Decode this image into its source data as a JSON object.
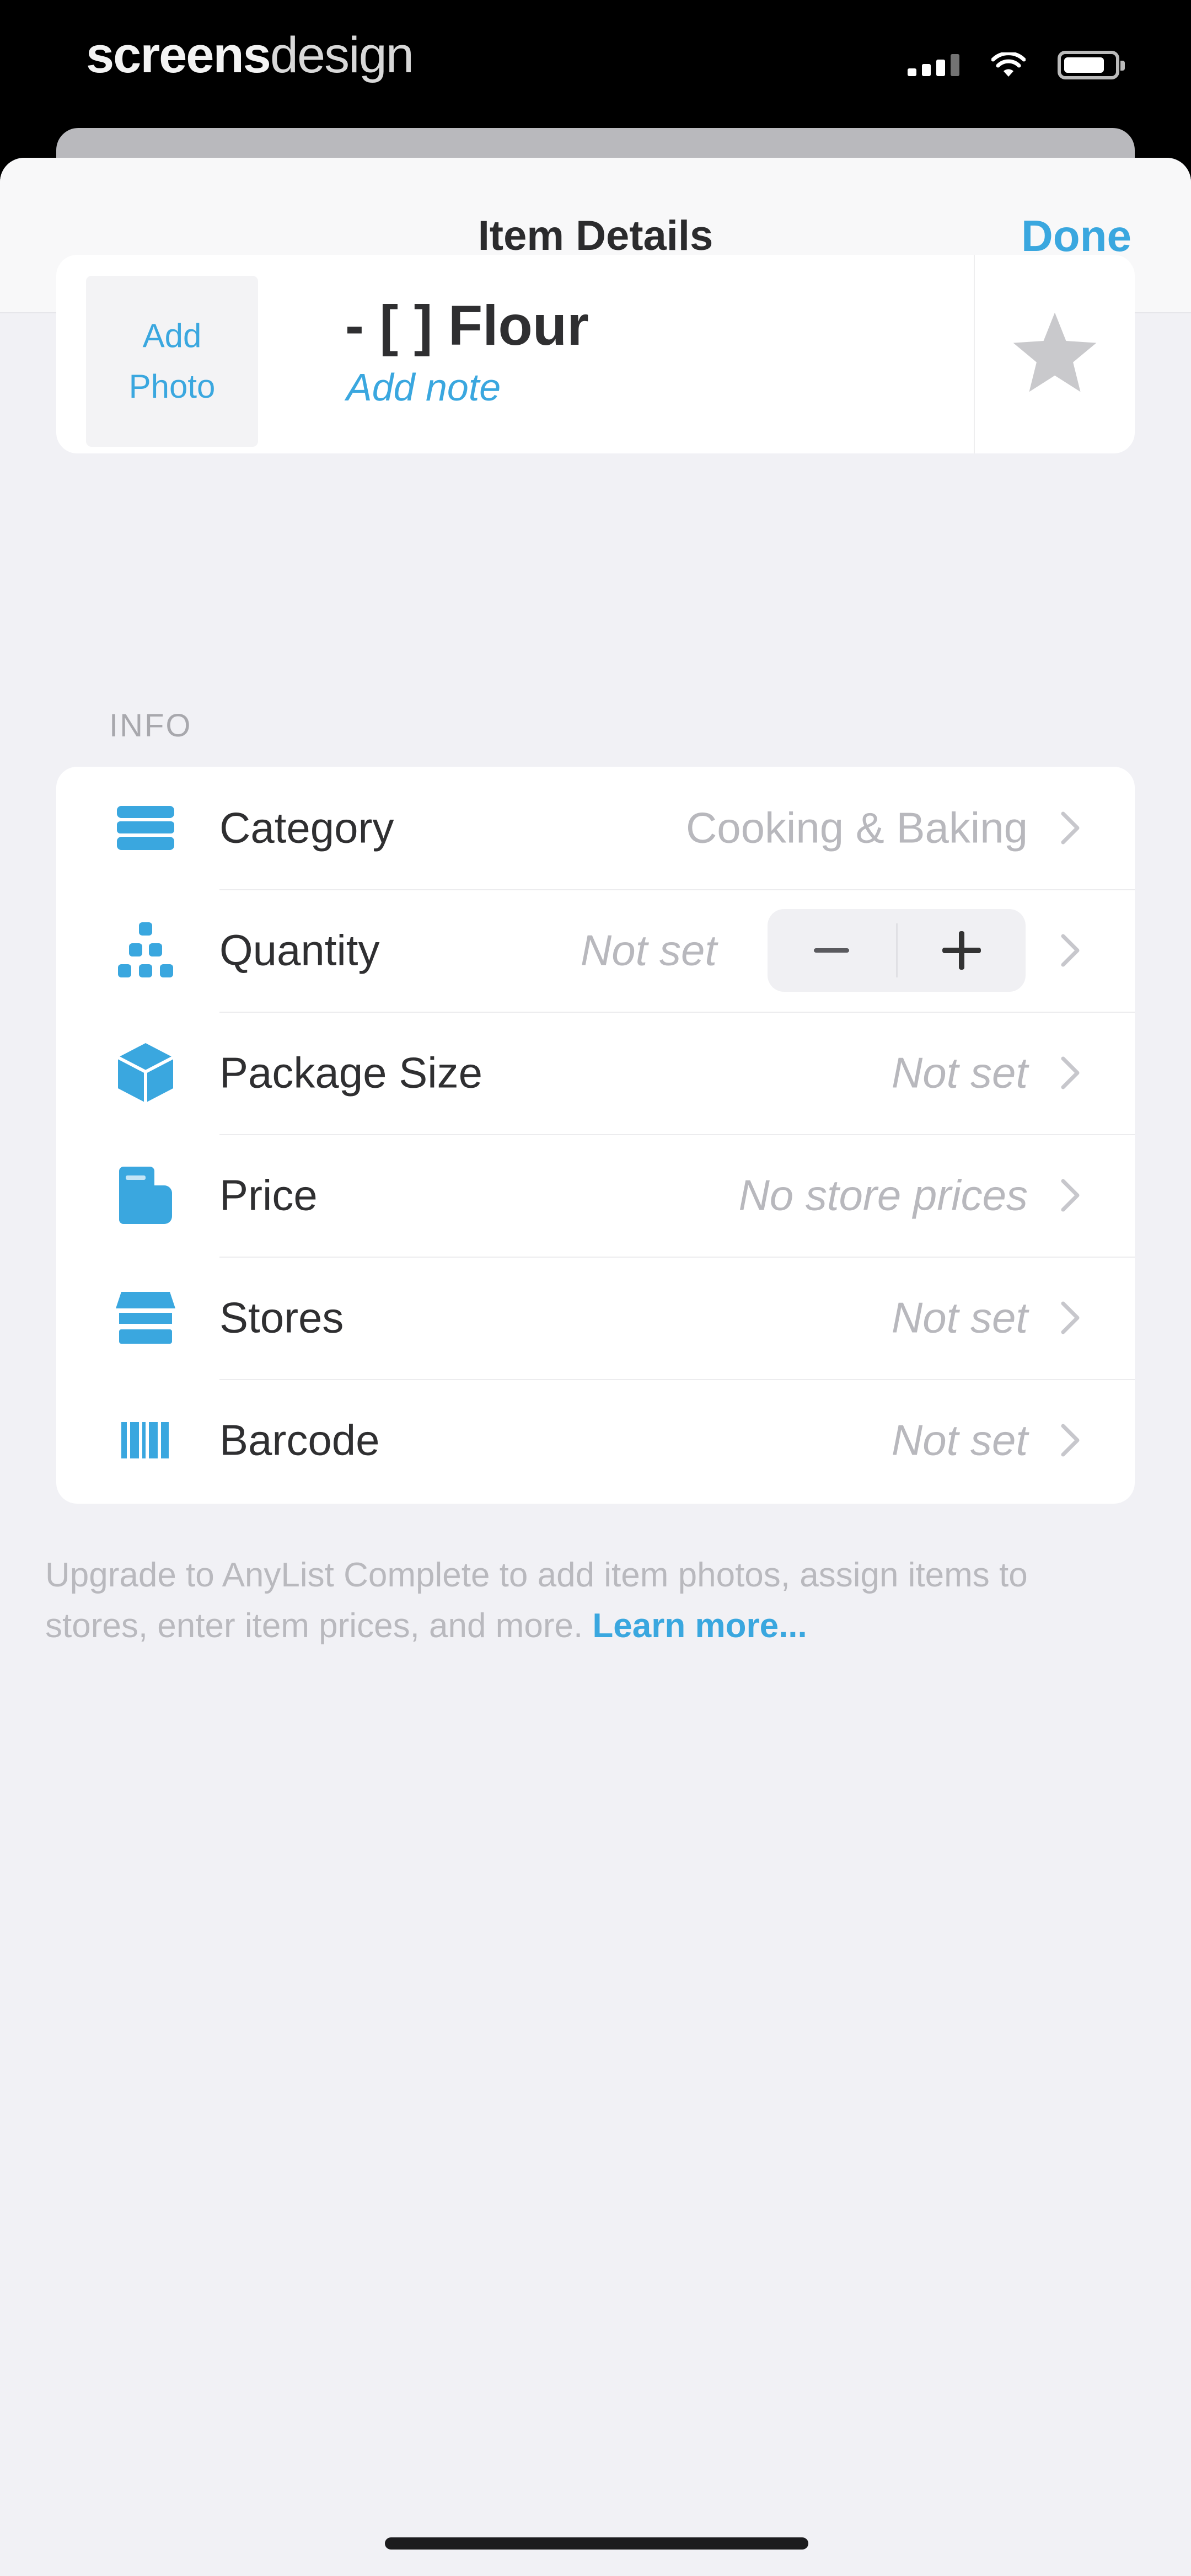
{
  "status_bar": {
    "brand_bold": "screens",
    "brand_light": "design"
  },
  "navbar": {
    "title": "Item Details",
    "done_label": "Done"
  },
  "item": {
    "photo_label_line1": "Add",
    "photo_label_line2": "Photo",
    "name": "- [ ] Flour",
    "note_placeholder": "Add note",
    "favorite_icon": "star-icon"
  },
  "info": {
    "section_title": "INFO",
    "rows": [
      {
        "label": "Category",
        "value": "Cooking & Baking",
        "icon": "category-stack-icon"
      },
      {
        "label": "Quantity",
        "value": "Not set",
        "icon": "quantity-pyramid-icon"
      },
      {
        "label": "Package Size",
        "value": "Not set",
        "icon": "package-box-icon"
      },
      {
        "label": "Price",
        "value": "No store prices",
        "icon": "price-tag-icon"
      },
      {
        "label": "Stores",
        "value": "Not set",
        "icon": "storefront-icon"
      },
      {
        "label": "Barcode",
        "value": "Not set",
        "icon": "barcode-icon"
      }
    ]
  },
  "footer": {
    "text": "Upgrade to AnyList Complete to add item photos, assign items to stores, enter item prices, and more.",
    "link": "Learn more..."
  },
  "colors": {
    "accent": "#3aa7df",
    "background": "#f1f1f5"
  }
}
